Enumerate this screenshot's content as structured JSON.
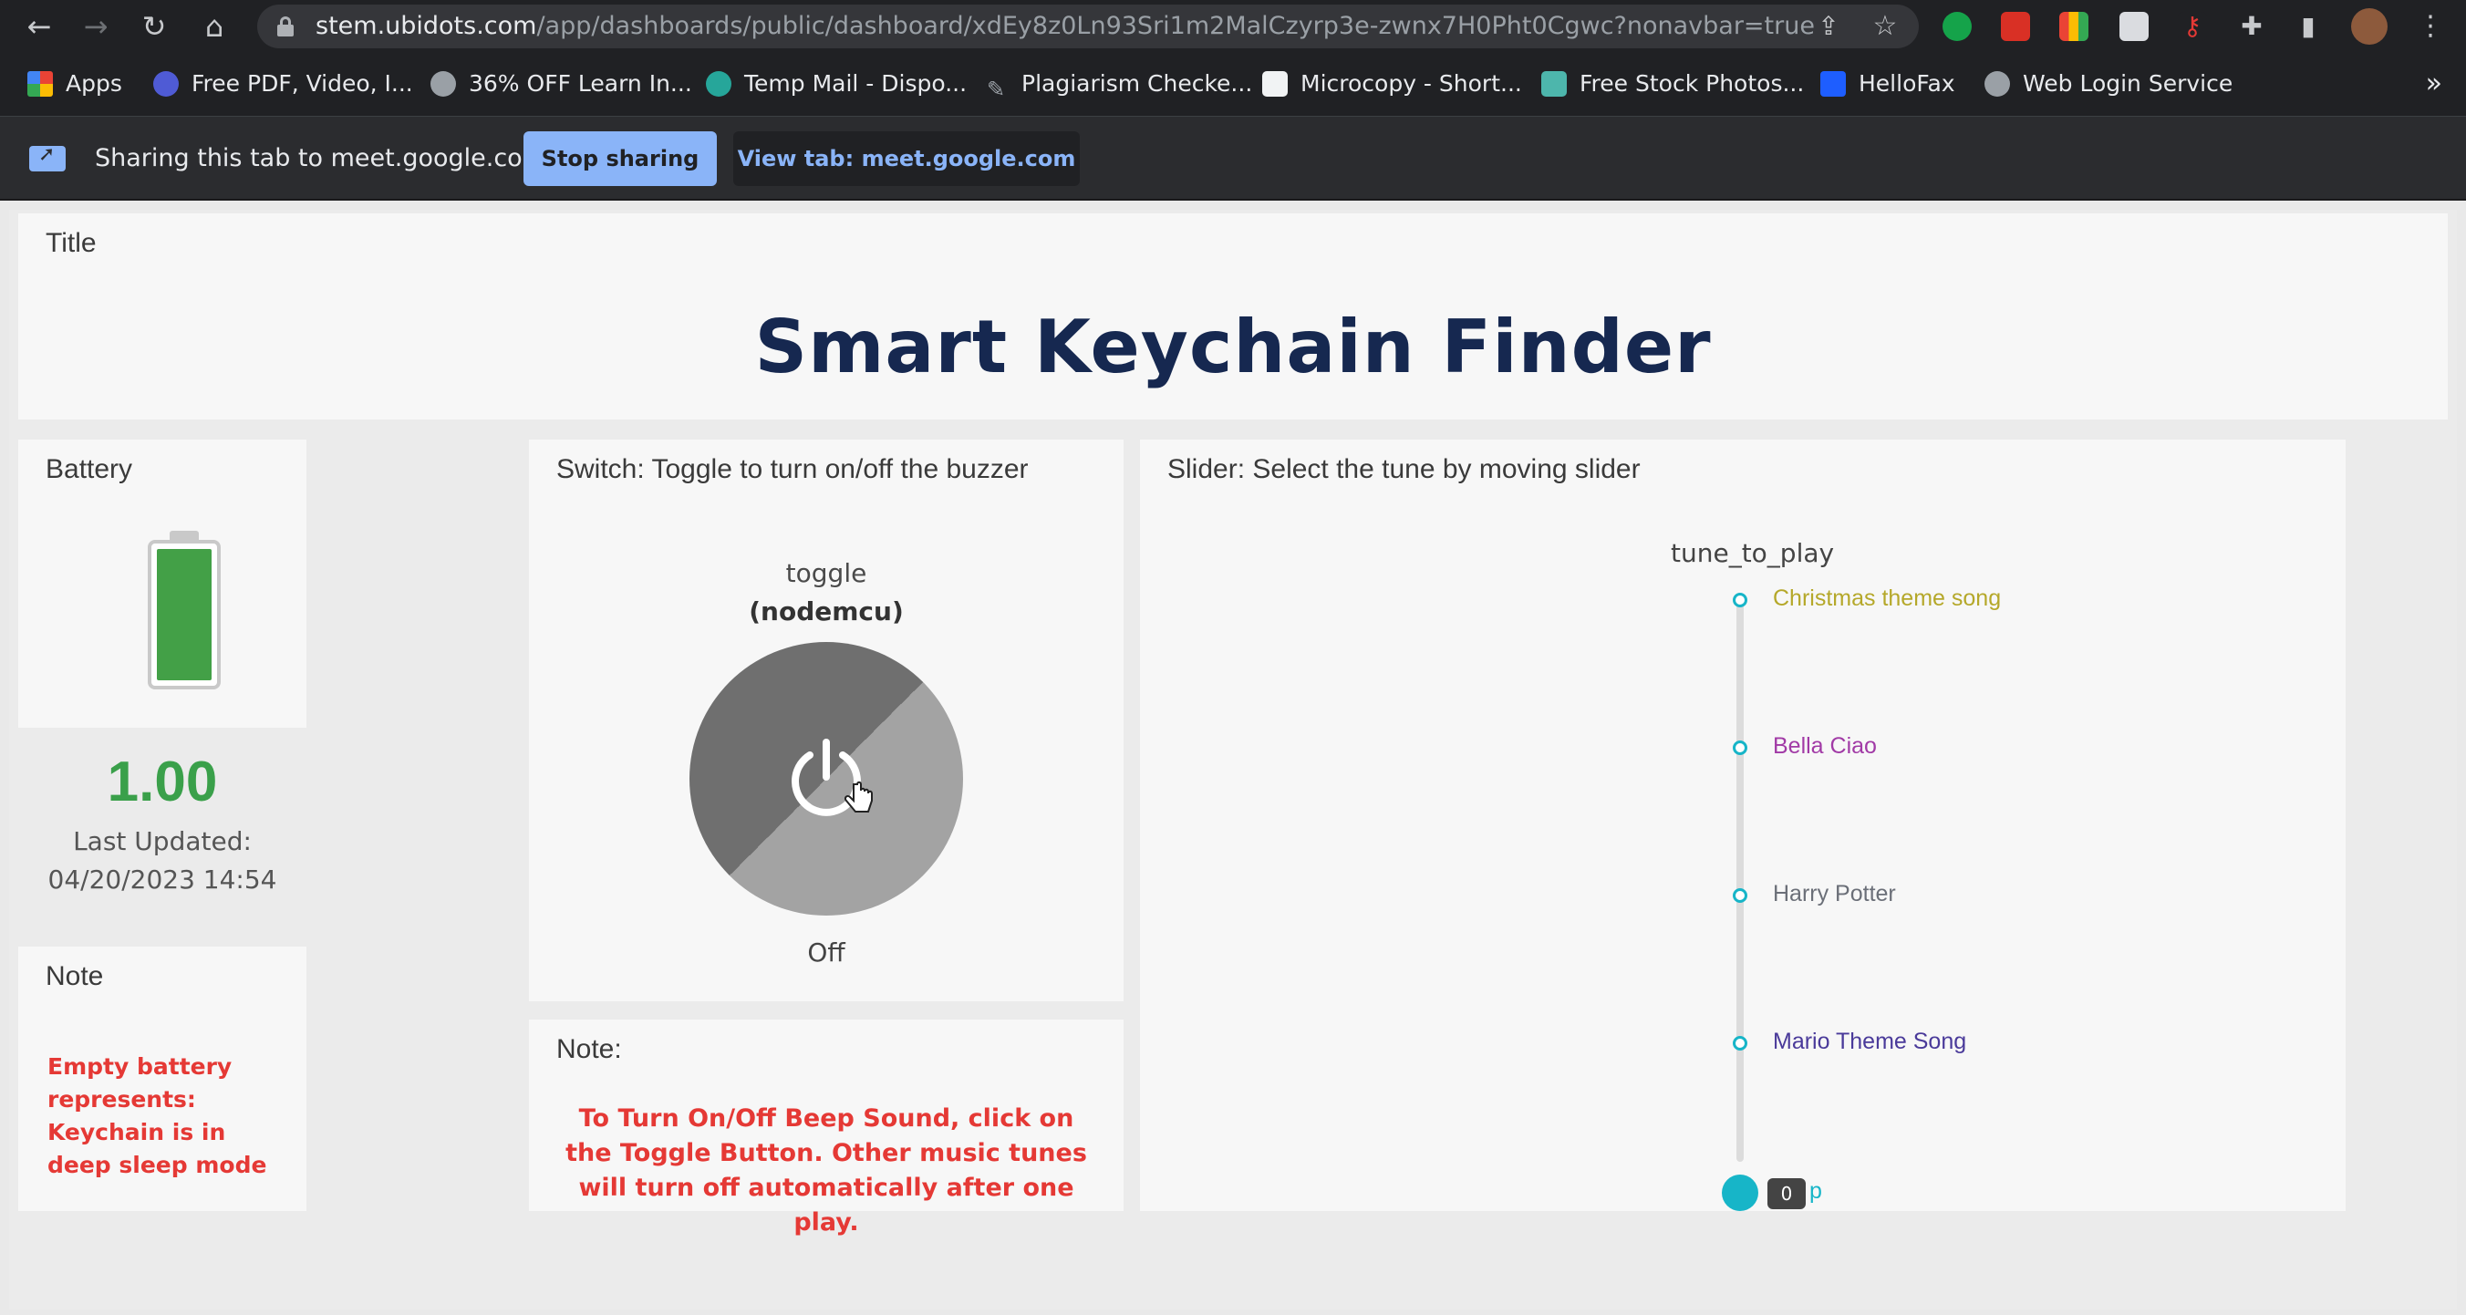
{
  "browser": {
    "url_host": "stem.ubidots.com",
    "url_path": "/app/dashboards/public/dashboard/xdEy8z0Ln93Sri1m2MalCzyrp3e-zwnx7H0Pht0Cgwc?nonavbar=true",
    "bookmarks": [
      {
        "label": "Apps",
        "color": "#ea4335"
      },
      {
        "label": "Free PDF, Video, I...",
        "color": "#4f5bd5"
      },
      {
        "label": "36% OFF Learn In...",
        "color": "#9aa0a6"
      },
      {
        "label": "Temp Mail - Dispo...",
        "color": "#26a69a"
      },
      {
        "label": "Plagiarism Checke...",
        "color": "#9aa0a6"
      },
      {
        "label": "Microcopy - Short...",
        "color": "#111111"
      },
      {
        "label": "Free Stock Photos...",
        "color": "#4db6ac"
      },
      {
        "label": "HelloFax",
        "color": "#1e5eff"
      },
      {
        "label": "Web Login Service",
        "color": "#9aa0a6"
      }
    ],
    "bookmarks_more": "»"
  },
  "sharing": {
    "message": "Sharing this tab to meet.google.com",
    "stop_label": "Stop sharing",
    "view_label": "View tab: meet.google.com"
  },
  "dashboard": {
    "title_card": {
      "label": "Title",
      "heading": "Smart Keychain Finder"
    },
    "battery": {
      "label": "Battery",
      "value": "1.00",
      "level": 1.0,
      "updated_label": "Last Updated:",
      "updated_at": "04/20/2023 14:54",
      "color": "#43a047"
    },
    "battery_note": {
      "label": "Note",
      "text": "Empty battery represents: Keychain is in deep sleep mode"
    },
    "switch": {
      "label": "Switch: Toggle to turn on/off the buzzer",
      "variable": "toggle",
      "device": "(nodemcu)",
      "state": "Off"
    },
    "switch_note": {
      "label": "Note:",
      "text": "To Turn On/Off Beep Sound, click on the Toggle Button. Other music tunes will turn off automatically after one play."
    },
    "slider": {
      "label": "Slider: Select the tune by moving slider",
      "variable": "tune_to_play",
      "tunes": [
        {
          "name": "Christmas theme song",
          "color": "#b5a82a"
        },
        {
          "name": "Bella Ciao",
          "color": "#a13aa6"
        },
        {
          "name": "Harry Potter",
          "color": "#6b6f78"
        },
        {
          "name": "Mario Theme Song",
          "color": "#4a3a9a"
        }
      ],
      "current_value": "0",
      "current_tune_tail": "p",
      "accent": "#17b5c8"
    }
  }
}
